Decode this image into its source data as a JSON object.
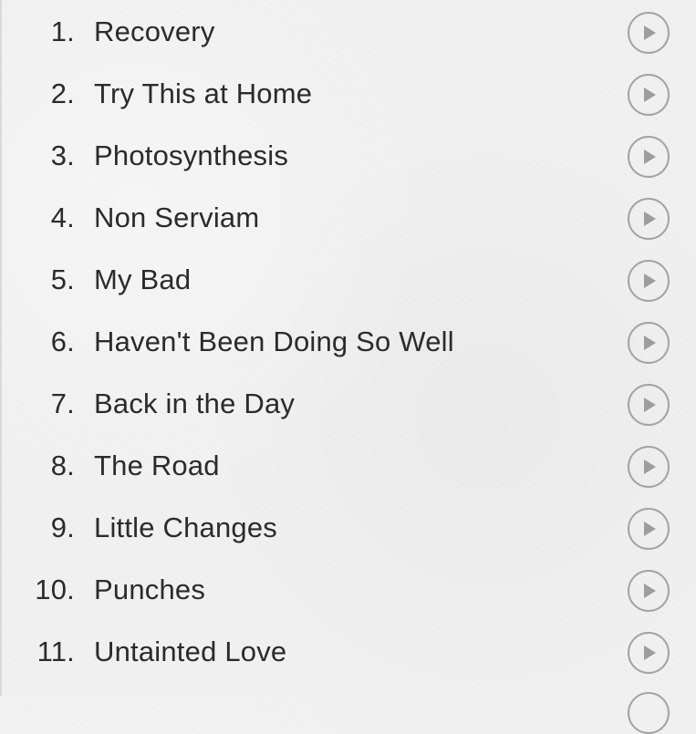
{
  "tracklist": [
    {
      "number": "1.",
      "title": "Recovery",
      "play_icon": "play-icon"
    },
    {
      "number": "2.",
      "title": "Try This at Home",
      "play_icon": "play-icon"
    },
    {
      "number": "3.",
      "title": "Photosynthesis",
      "play_icon": "play-icon"
    },
    {
      "number": "4.",
      "title": "Non Serviam",
      "play_icon": "play-icon"
    },
    {
      "number": "5.",
      "title": "My Bad",
      "play_icon": "play-icon"
    },
    {
      "number": "6.",
      "title": "Haven't Been Doing So Well",
      "play_icon": "play-icon"
    },
    {
      "number": "7.",
      "title": "Back in the Day",
      "play_icon": "play-icon"
    },
    {
      "number": "8.",
      "title": "The Road",
      "play_icon": "play-icon"
    },
    {
      "number": "9.",
      "title": "Little Changes",
      "play_icon": "play-icon"
    },
    {
      "number": "10.",
      "title": "Punches",
      "play_icon": "play-icon"
    },
    {
      "number": "11.",
      "title": "Untainted Love",
      "play_icon": "play-icon"
    }
  ],
  "colors": {
    "background": "#f1f1f1",
    "text": "#2b2b2b",
    "play_button_outline": "#a3a3a3"
  }
}
